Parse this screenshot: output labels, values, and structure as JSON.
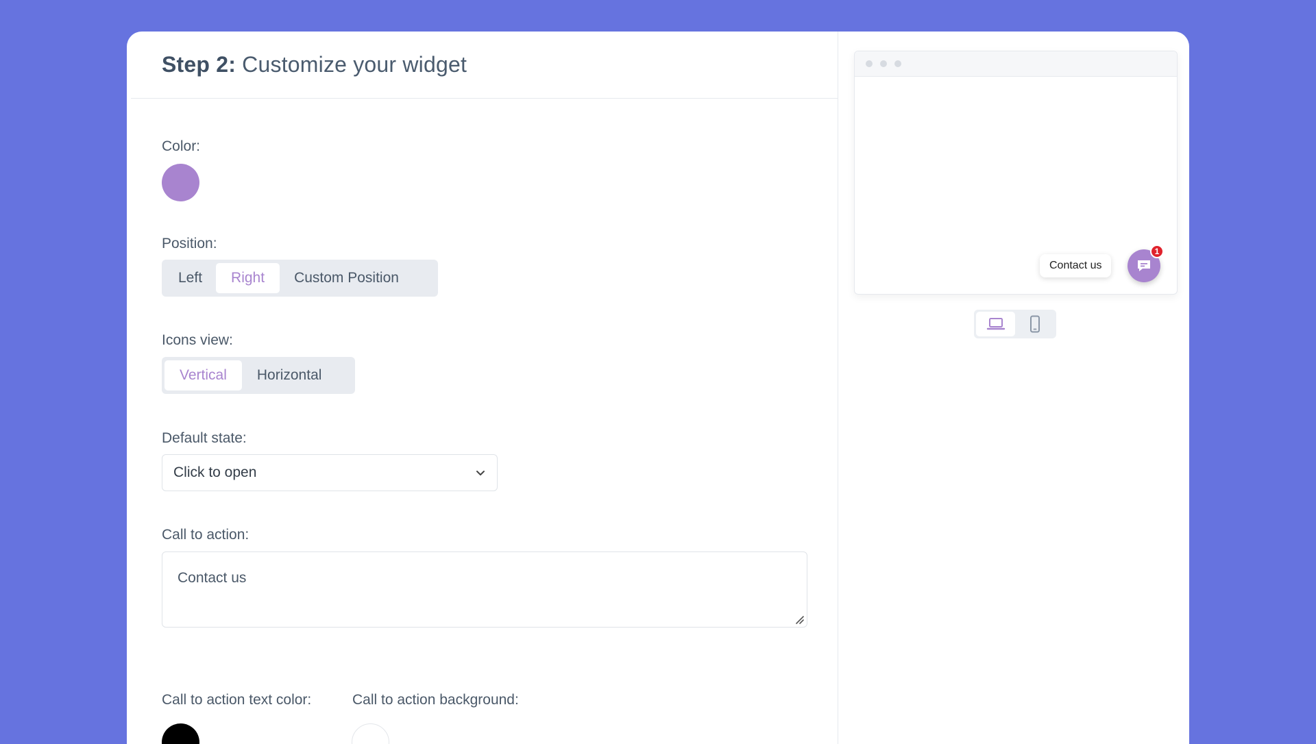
{
  "header": {
    "step": "Step 2:",
    "title": " Customize your widget"
  },
  "color": {
    "label": "Color:",
    "value": "#a884cf"
  },
  "position": {
    "label": "Position:",
    "options": [
      "Left",
      "Right",
      "Custom Position"
    ],
    "selected": "Right"
  },
  "icons_view": {
    "label": "Icons view:",
    "options": [
      "Vertical",
      "Horizontal"
    ],
    "selected": "Vertical"
  },
  "default_state": {
    "label": "Default state:",
    "value": "Click to open"
  },
  "call_to_action": {
    "label": "Call to action:",
    "value": "Contact us"
  },
  "cta_text_color": {
    "label": "Call to action text color:",
    "value": "#000000"
  },
  "cta_background": {
    "label": "Call to action background:",
    "value": "#ffffff"
  },
  "preview": {
    "cta_text": "Contact us",
    "badge_count": "1",
    "devices": [
      "laptop-icon",
      "mobile-icon"
    ],
    "selected_device": "laptop-icon"
  },
  "colors": {
    "background": "#6673df",
    "accent": "#a884cf",
    "badge": "#e0222c"
  }
}
